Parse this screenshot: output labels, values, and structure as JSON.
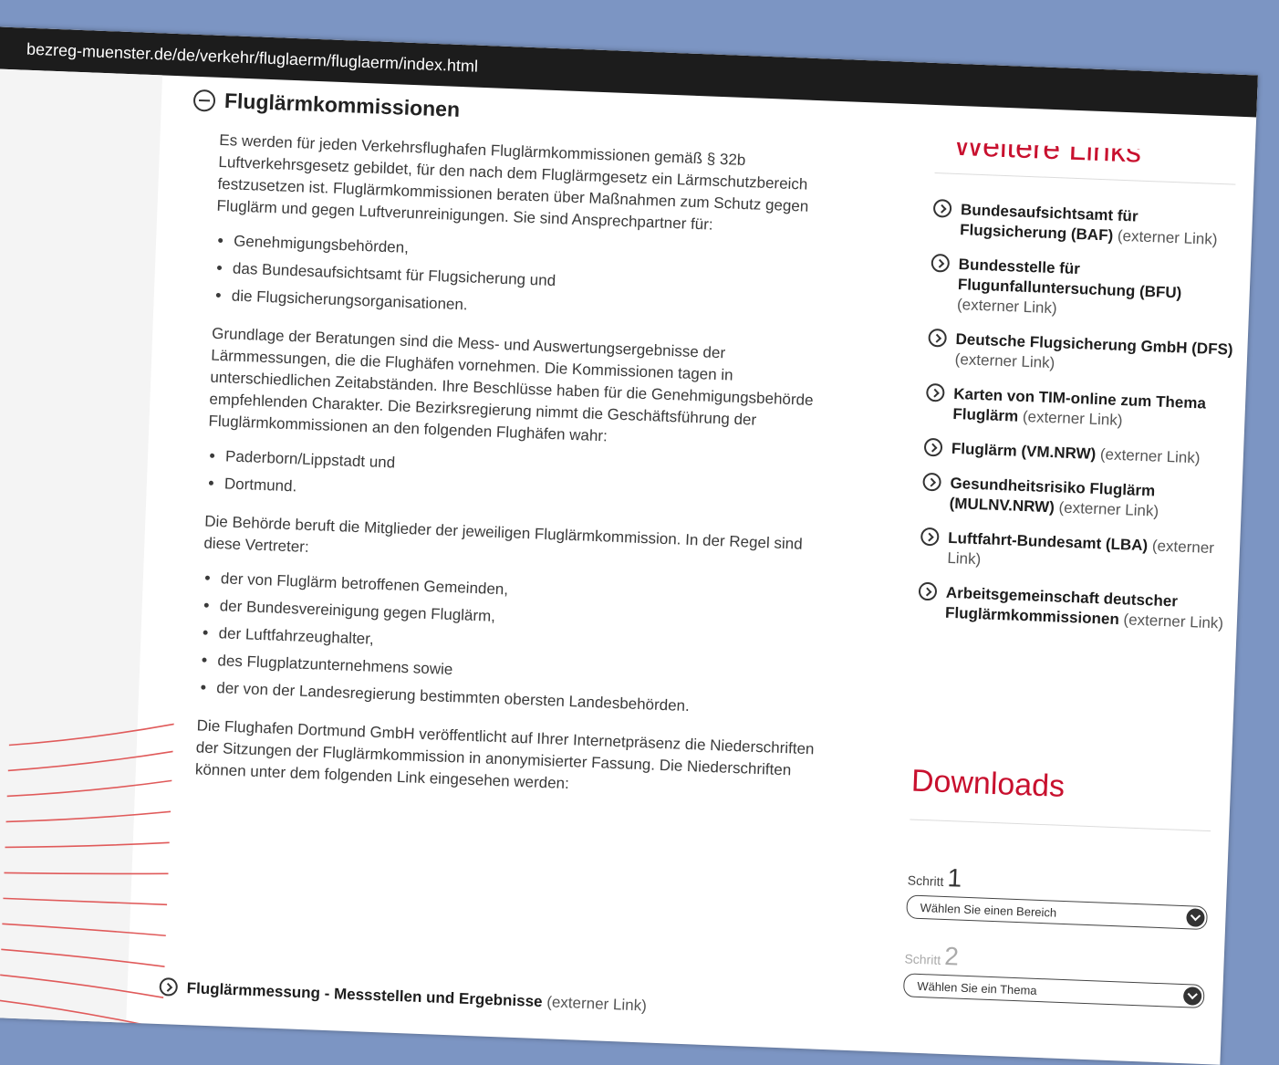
{
  "browser": {
    "url": "bezreg-muenster.de/de/verkehr/fluglaerm/fluglaerm/index.html"
  },
  "section": {
    "title": "Fluglärmkommissionen",
    "p1": "Es werden für jeden Verkehrsflughafen Fluglärmkommissionen gemäß § 32b Luftverkehrsgesetz gebildet, für den nach dem Fluglärmgesetz ein Lärmschutzbereich festzusetzen ist. Fluglärmkommissionen beraten über Maßnahmen zum Schutz gegen Fluglärm und gegen Luftverunreinigungen. Sie sind Ansprechpartner für:",
    "list1": [
      "Genehmigungsbehörden,",
      "das Bundesaufsichtsamt für Flugsicherung und",
      "die Flugsicherungsorganisationen."
    ],
    "p2": "Grundlage der Beratungen sind die Mess- und Auswertungsergebnisse der Lärmmessungen, die die Flughäfen vornehmen. Die Kommissionen tagen in unterschiedlichen Zeitabständen. Ihre Beschlüsse haben für die Genehmigungsbehörde empfehlenden Charakter. Die Bezirksregierung nimmt die Geschäftsführung der Fluglärmkommissionen an den folgenden Flughäfen wahr:",
    "list2": [
      "Paderborn/Lippstadt und",
      "Dortmund."
    ],
    "p3": "Die Behörde beruft die Mitglieder der jeweiligen Fluglärmkommission. In der Regel sind diese Vertreter:",
    "list3": [
      "der von Fluglärm betroffenen Gemeinden,",
      "der Bundesvereinigung gegen Fluglärm,",
      "der Luftfahrzeughalter,",
      "des Flugplatzunternehmens sowie",
      "der von der Landesregierung bestimmten obersten Landesbehörden."
    ],
    "p4": "Die Flughafen Dortmund GmbH veröffentlicht auf Ihrer Internetpräsenz die Niederschriften der Sitzungen der Fluglärmkommission in anonymisierter Fassung. Die Niederschriften können unter dem folgenden Link eingesehen werden:",
    "bottom_link": {
      "title": "Fluglärmmessung - Messstellen und Ergebnisse",
      "ext": "(externer Link)"
    }
  },
  "sidebar": {
    "heading": "Weitere Links",
    "links": [
      {
        "title": "Bundesaufsichtsamt für Flugsicherung (BAF)",
        "ext": "(externer Link)"
      },
      {
        "title": "Bundesstelle für Flugunfalluntersuchung (BFU)",
        "ext": "(externer Link)"
      },
      {
        "title": "Deutsche Flugsicherung GmbH (DFS)",
        "ext": "(externer Link)"
      },
      {
        "title": "Karten von TIM-online zum Thema Fluglärm",
        "ext": "(externer Link)"
      },
      {
        "title": "Fluglärm (VM.NRW)",
        "ext": "(externer Link)"
      },
      {
        "title": "Gesundheitsrisiko Fluglärm (MULNV.NRW)",
        "ext": "(externer Link)"
      },
      {
        "title": "Luftfahrt-Bundesamt (LBA)",
        "ext": "(externer Link)"
      },
      {
        "title": "Arbeitsgemeinschaft deutscher Fluglärmkommissionen",
        "ext": "(externer Link)"
      }
    ],
    "downloads": {
      "title": "Downloads",
      "step_label": "Schritt",
      "step1_num": "1",
      "step1_placeholder": "Wählen Sie einen Bereich",
      "step2_num": "2",
      "step2_placeholder": "Wählen Sie ein Thema"
    }
  },
  "colors": {
    "accent": "#c8102e",
    "background": "#7c95c3",
    "urlbar": "#1c1c1c"
  }
}
